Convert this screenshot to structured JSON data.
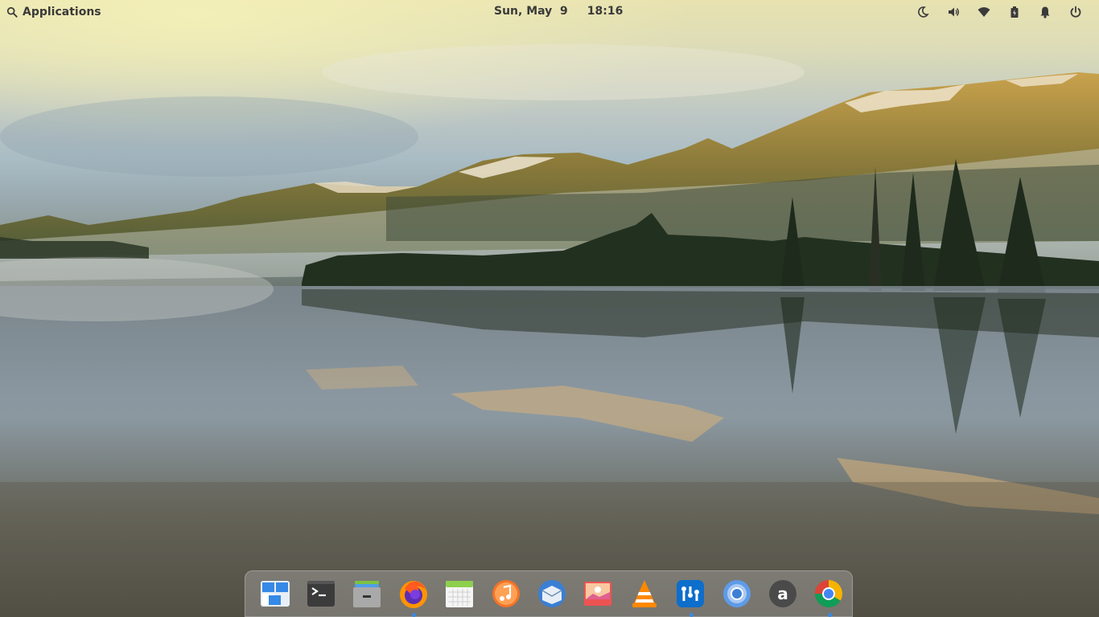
{
  "panel": {
    "applications_label": "Applications",
    "date": "Sun, May  9",
    "time": "18:16",
    "indicators": [
      "night-light-icon",
      "volume-icon",
      "wifi-icon",
      "battery-icon",
      "notifications-icon",
      "power-icon"
    ]
  },
  "dock": {
    "apps": [
      {
        "name": "multitasking-view-icon",
        "running": false
      },
      {
        "name": "terminal-icon",
        "running": false
      },
      {
        "name": "files-icon",
        "running": false
      },
      {
        "name": "firefox-icon",
        "running": true
      },
      {
        "name": "calendar-icon",
        "running": false
      },
      {
        "name": "music-icon",
        "running": false
      },
      {
        "name": "mail-icon",
        "running": false
      },
      {
        "name": "photos-icon",
        "running": false
      },
      {
        "name": "vlc-icon",
        "running": false
      },
      {
        "name": "system-monitor-icon",
        "running": true
      },
      {
        "name": "chromium-icon",
        "running": false
      },
      {
        "name": "appcenter-icon",
        "running": false
      },
      {
        "name": "chrome-icon",
        "running": true
      }
    ]
  },
  "colors": {
    "accent": "#3689e6",
    "panel_text": "#3a3a3a"
  }
}
